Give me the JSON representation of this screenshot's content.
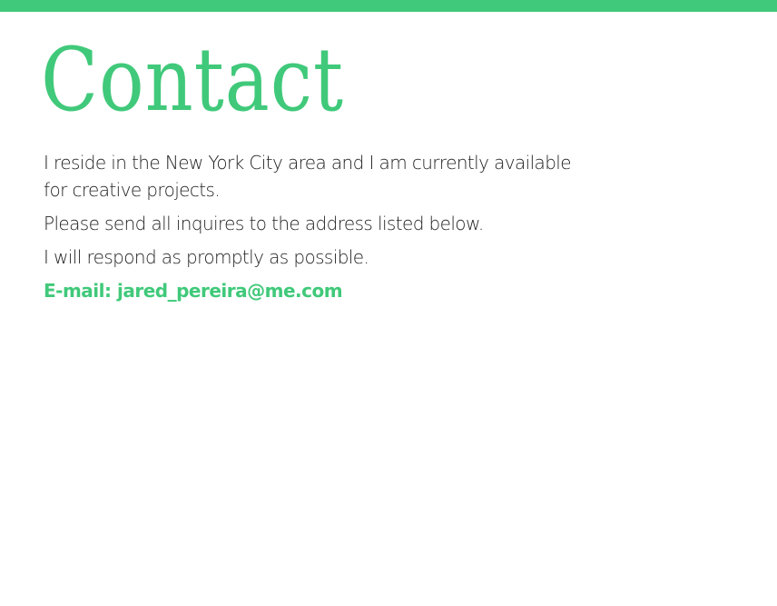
{
  "colors": {
    "accent": "#40c97a",
    "text": "#222222",
    "background": "#ffffff"
  },
  "page": {
    "title": "Contact",
    "paragraphs": [
      "I reside in the New York City area and I am currently available for creative projects.",
      "Please send all inquires to the address listed below.",
      "I will respond as promptly as possible."
    ],
    "email_label": "E-mail:",
    "email_address": "jared_pereira@me.com"
  }
}
